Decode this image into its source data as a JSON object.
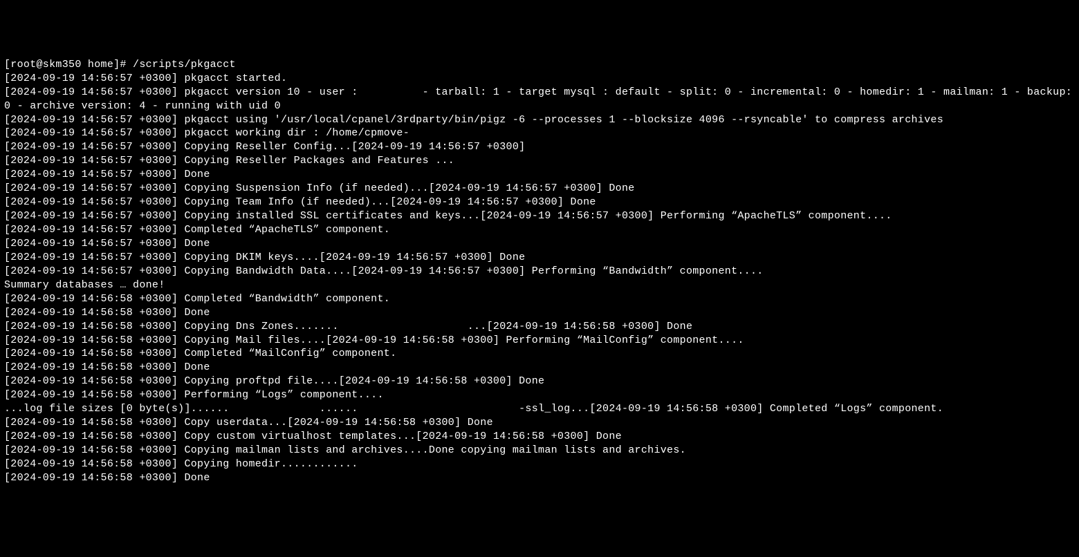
{
  "prompt": "[root@skm350 home]# /scripts/pkgacct",
  "lines": [
    "[2024-09-19 14:56:57 +0300] pkgacct started.",
    "[2024-09-19 14:56:57 +0300] pkgacct version 10 - user :          - tarball: 1 - target mysql : default - split: 0 - incremental: 0 - homedir: 1 - mailman: 1 - backup: 0 - archive version: 4 - running with uid 0",
    "[2024-09-19 14:56:57 +0300] pkgacct using '/usr/local/cpanel/3rdparty/bin/pigz -6 --processes 1 --blocksize 4096 --rsyncable' to compress archives",
    "[2024-09-19 14:56:57 +0300] pkgacct working dir : /home/cpmove-",
    "[2024-09-19 14:56:57 +0300] Copying Reseller Config...[2024-09-19 14:56:57 +0300]",
    "[2024-09-19 14:56:57 +0300] Copying Reseller Packages and Features ...",
    "[2024-09-19 14:56:57 +0300] Done",
    "[2024-09-19 14:56:57 +0300] Copying Suspension Info (if needed)...[2024-09-19 14:56:57 +0300] Done",
    "[2024-09-19 14:56:57 +0300] Copying Team Info (if needed)...[2024-09-19 14:56:57 +0300] Done",
    "[2024-09-19 14:56:57 +0300] Copying installed SSL certificates and keys...[2024-09-19 14:56:57 +0300] Performing “ApacheTLS” component....",
    "[2024-09-19 14:56:57 +0300] Completed “ApacheTLS” component.",
    "[2024-09-19 14:56:57 +0300] Done",
    "[2024-09-19 14:56:57 +0300] Copying DKIM keys....[2024-09-19 14:56:57 +0300] Done",
    "[2024-09-19 14:56:57 +0300] Copying Bandwidth Data....[2024-09-19 14:56:57 +0300] Performing “Bandwidth” component....",
    "Summary databases … done!",
    "[2024-09-19 14:56:58 +0300] Completed “Bandwidth” component.",
    "[2024-09-19 14:56:58 +0300] Done",
    "[2024-09-19 14:56:58 +0300] Copying Dns Zones.......                    ...[2024-09-19 14:56:58 +0300] Done",
    "[2024-09-19 14:56:58 +0300] Copying Mail files....[2024-09-19 14:56:58 +0300] Performing “MailConfig” component....",
    "[2024-09-19 14:56:58 +0300] Completed “MailConfig” component.",
    "[2024-09-19 14:56:58 +0300] Done",
    "[2024-09-19 14:56:58 +0300] Copying proftpd file....[2024-09-19 14:56:58 +0300] Done",
    "[2024-09-19 14:56:58 +0300] Performing “Logs” component....",
    "...log file sizes [0 byte(s)]......              ......                         -ssl_log...[2024-09-19 14:56:58 +0300] Completed “Logs” component.",
    "[2024-09-19 14:56:58 +0300] Copy userdata...[2024-09-19 14:56:58 +0300] Done",
    "[2024-09-19 14:56:58 +0300] Copy custom virtualhost templates...[2024-09-19 14:56:58 +0300] Done",
    "[2024-09-19 14:56:58 +0300] Copying mailman lists and archives....Done copying mailman lists and archives.",
    "[2024-09-19 14:56:58 +0300] Copying homedir............",
    "[2024-09-19 14:56:58 +0300] Done"
  ]
}
